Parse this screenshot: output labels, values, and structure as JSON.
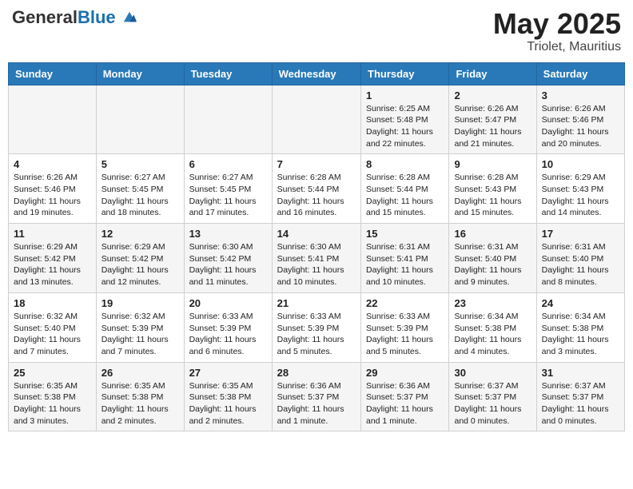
{
  "header": {
    "logo_general": "General",
    "logo_blue": "Blue",
    "month": "May 2025",
    "location": "Triolet, Mauritius"
  },
  "days_of_week": [
    "Sunday",
    "Monday",
    "Tuesday",
    "Wednesday",
    "Thursday",
    "Friday",
    "Saturday"
  ],
  "weeks": [
    [
      null,
      null,
      null,
      null,
      {
        "day": 1,
        "sunrise": "6:25 AM",
        "sunset": "5:48 PM",
        "daylight": "11 hours and 22 minutes."
      },
      {
        "day": 2,
        "sunrise": "6:26 AM",
        "sunset": "5:47 PM",
        "daylight": "11 hours and 21 minutes."
      },
      {
        "day": 3,
        "sunrise": "6:26 AM",
        "sunset": "5:46 PM",
        "daylight": "11 hours and 20 minutes."
      }
    ],
    [
      {
        "day": 4,
        "sunrise": "6:26 AM",
        "sunset": "5:46 PM",
        "daylight": "11 hours and 19 minutes."
      },
      {
        "day": 5,
        "sunrise": "6:27 AM",
        "sunset": "5:45 PM",
        "daylight": "11 hours and 18 minutes."
      },
      {
        "day": 6,
        "sunrise": "6:27 AM",
        "sunset": "5:45 PM",
        "daylight": "11 hours and 17 minutes."
      },
      {
        "day": 7,
        "sunrise": "6:28 AM",
        "sunset": "5:44 PM",
        "daylight": "11 hours and 16 minutes."
      },
      {
        "day": 8,
        "sunrise": "6:28 AM",
        "sunset": "5:44 PM",
        "daylight": "11 hours and 15 minutes."
      },
      {
        "day": 9,
        "sunrise": "6:28 AM",
        "sunset": "5:43 PM",
        "daylight": "11 hours and 15 minutes."
      },
      {
        "day": 10,
        "sunrise": "6:29 AM",
        "sunset": "5:43 PM",
        "daylight": "11 hours and 14 minutes."
      }
    ],
    [
      {
        "day": 11,
        "sunrise": "6:29 AM",
        "sunset": "5:42 PM",
        "daylight": "11 hours and 13 minutes."
      },
      {
        "day": 12,
        "sunrise": "6:29 AM",
        "sunset": "5:42 PM",
        "daylight": "11 hours and 12 minutes."
      },
      {
        "day": 13,
        "sunrise": "6:30 AM",
        "sunset": "5:42 PM",
        "daylight": "11 hours and 11 minutes."
      },
      {
        "day": 14,
        "sunrise": "6:30 AM",
        "sunset": "5:41 PM",
        "daylight": "11 hours and 10 minutes."
      },
      {
        "day": 15,
        "sunrise": "6:31 AM",
        "sunset": "5:41 PM",
        "daylight": "11 hours and 10 minutes."
      },
      {
        "day": 16,
        "sunrise": "6:31 AM",
        "sunset": "5:40 PM",
        "daylight": "11 hours and 9 minutes."
      },
      {
        "day": 17,
        "sunrise": "6:31 AM",
        "sunset": "5:40 PM",
        "daylight": "11 hours and 8 minutes."
      }
    ],
    [
      {
        "day": 18,
        "sunrise": "6:32 AM",
        "sunset": "5:40 PM",
        "daylight": "11 hours and 7 minutes."
      },
      {
        "day": 19,
        "sunrise": "6:32 AM",
        "sunset": "5:39 PM",
        "daylight": "11 hours and 7 minutes."
      },
      {
        "day": 20,
        "sunrise": "6:33 AM",
        "sunset": "5:39 PM",
        "daylight": "11 hours and 6 minutes."
      },
      {
        "day": 21,
        "sunrise": "6:33 AM",
        "sunset": "5:39 PM",
        "daylight": "11 hours and 5 minutes."
      },
      {
        "day": 22,
        "sunrise": "6:33 AM",
        "sunset": "5:39 PM",
        "daylight": "11 hours and 5 minutes."
      },
      {
        "day": 23,
        "sunrise": "6:34 AM",
        "sunset": "5:38 PM",
        "daylight": "11 hours and 4 minutes."
      },
      {
        "day": 24,
        "sunrise": "6:34 AM",
        "sunset": "5:38 PM",
        "daylight": "11 hours and 3 minutes."
      }
    ],
    [
      {
        "day": 25,
        "sunrise": "6:35 AM",
        "sunset": "5:38 PM",
        "daylight": "11 hours and 3 minutes."
      },
      {
        "day": 26,
        "sunrise": "6:35 AM",
        "sunset": "5:38 PM",
        "daylight": "11 hours and 2 minutes."
      },
      {
        "day": 27,
        "sunrise": "6:35 AM",
        "sunset": "5:38 PM",
        "daylight": "11 hours and 2 minutes."
      },
      {
        "day": 28,
        "sunrise": "6:36 AM",
        "sunset": "5:37 PM",
        "daylight": "11 hours and 1 minute."
      },
      {
        "day": 29,
        "sunrise": "6:36 AM",
        "sunset": "5:37 PM",
        "daylight": "11 hours and 1 minute."
      },
      {
        "day": 30,
        "sunrise": "6:37 AM",
        "sunset": "5:37 PM",
        "daylight": "11 hours and 0 minutes."
      },
      {
        "day": 31,
        "sunrise": "6:37 AM",
        "sunset": "5:37 PM",
        "daylight": "11 hours and 0 minutes."
      }
    ]
  ],
  "labels": {
    "sunrise": "Sunrise:",
    "sunset": "Sunset:",
    "daylight": "Daylight:"
  }
}
